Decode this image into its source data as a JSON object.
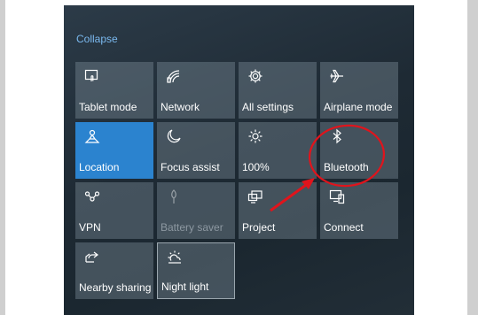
{
  "action_center": {
    "collapse_label": "Collapse",
    "tiles": [
      {
        "label": "Tablet mode",
        "icon": "tablet-mode-icon"
      },
      {
        "label": "Network",
        "icon": "network-icon"
      },
      {
        "label": "All settings",
        "icon": "gear-icon"
      },
      {
        "label": "Airplane mode",
        "icon": "airplane-icon"
      },
      {
        "label": "Location",
        "icon": "location-icon",
        "state": "on"
      },
      {
        "label": "Focus assist",
        "icon": "moon-icon"
      },
      {
        "label": "100%",
        "icon": "brightness-icon"
      },
      {
        "label": "Bluetooth",
        "icon": "bluetooth-icon"
      },
      {
        "label": "VPN",
        "icon": "vpn-icon"
      },
      {
        "label": "Battery saver",
        "icon": "battery-saver-icon",
        "state": "disabled"
      },
      {
        "label": "Project",
        "icon": "project-icon"
      },
      {
        "label": "Connect",
        "icon": "connect-icon"
      },
      {
        "label": "Nearby sharing",
        "icon": "nearby-sharing-icon"
      },
      {
        "label": "Night light",
        "icon": "night-light-icon"
      }
    ]
  },
  "colors": {
    "accent": "#2b83cf",
    "link": "#7ab8ee",
    "annotation": "#e0141c",
    "panel_bg": "#1e2a34"
  }
}
